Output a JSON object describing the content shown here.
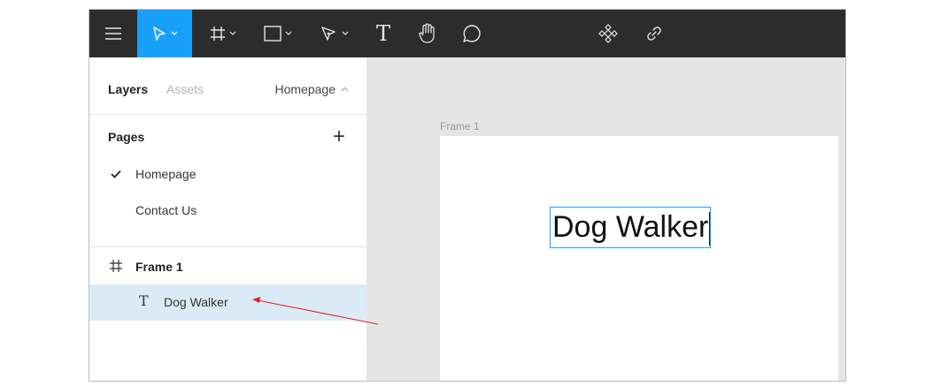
{
  "toolbar": {
    "tools": [
      {
        "name": "menu-icon"
      },
      {
        "name": "move-tool-icon",
        "active": true
      },
      {
        "name": "frame-tool-icon"
      },
      {
        "name": "shape-tool-icon"
      },
      {
        "name": "pen-tool-icon"
      },
      {
        "name": "text-tool-icon"
      },
      {
        "name": "hand-tool-icon"
      },
      {
        "name": "comment-tool-icon"
      },
      {
        "name": "component-icon"
      },
      {
        "name": "link-icon"
      }
    ],
    "text_tool_glyph": "T",
    "active_color": "#18a0fb",
    "bg_color": "#2c2c2c"
  },
  "panel": {
    "tab_layers": "Layers",
    "tab_assets": "Assets",
    "current_page": "Homepage",
    "pages_header": "Pages",
    "add_symbol": "+",
    "pages": [
      {
        "label": "Homepage",
        "selected": true
      },
      {
        "label": "Contact Us",
        "selected": false
      }
    ],
    "layers": [
      {
        "label": "Frame 1",
        "icon": "frame-icon"
      },
      {
        "label": "Dog Walker",
        "icon": "text-layer-icon",
        "glyph": "T",
        "selected": true
      }
    ]
  },
  "canvas": {
    "frame_label": "Frame 1",
    "text_content": "Dog Walker",
    "selection_color": "#18a0fb"
  }
}
